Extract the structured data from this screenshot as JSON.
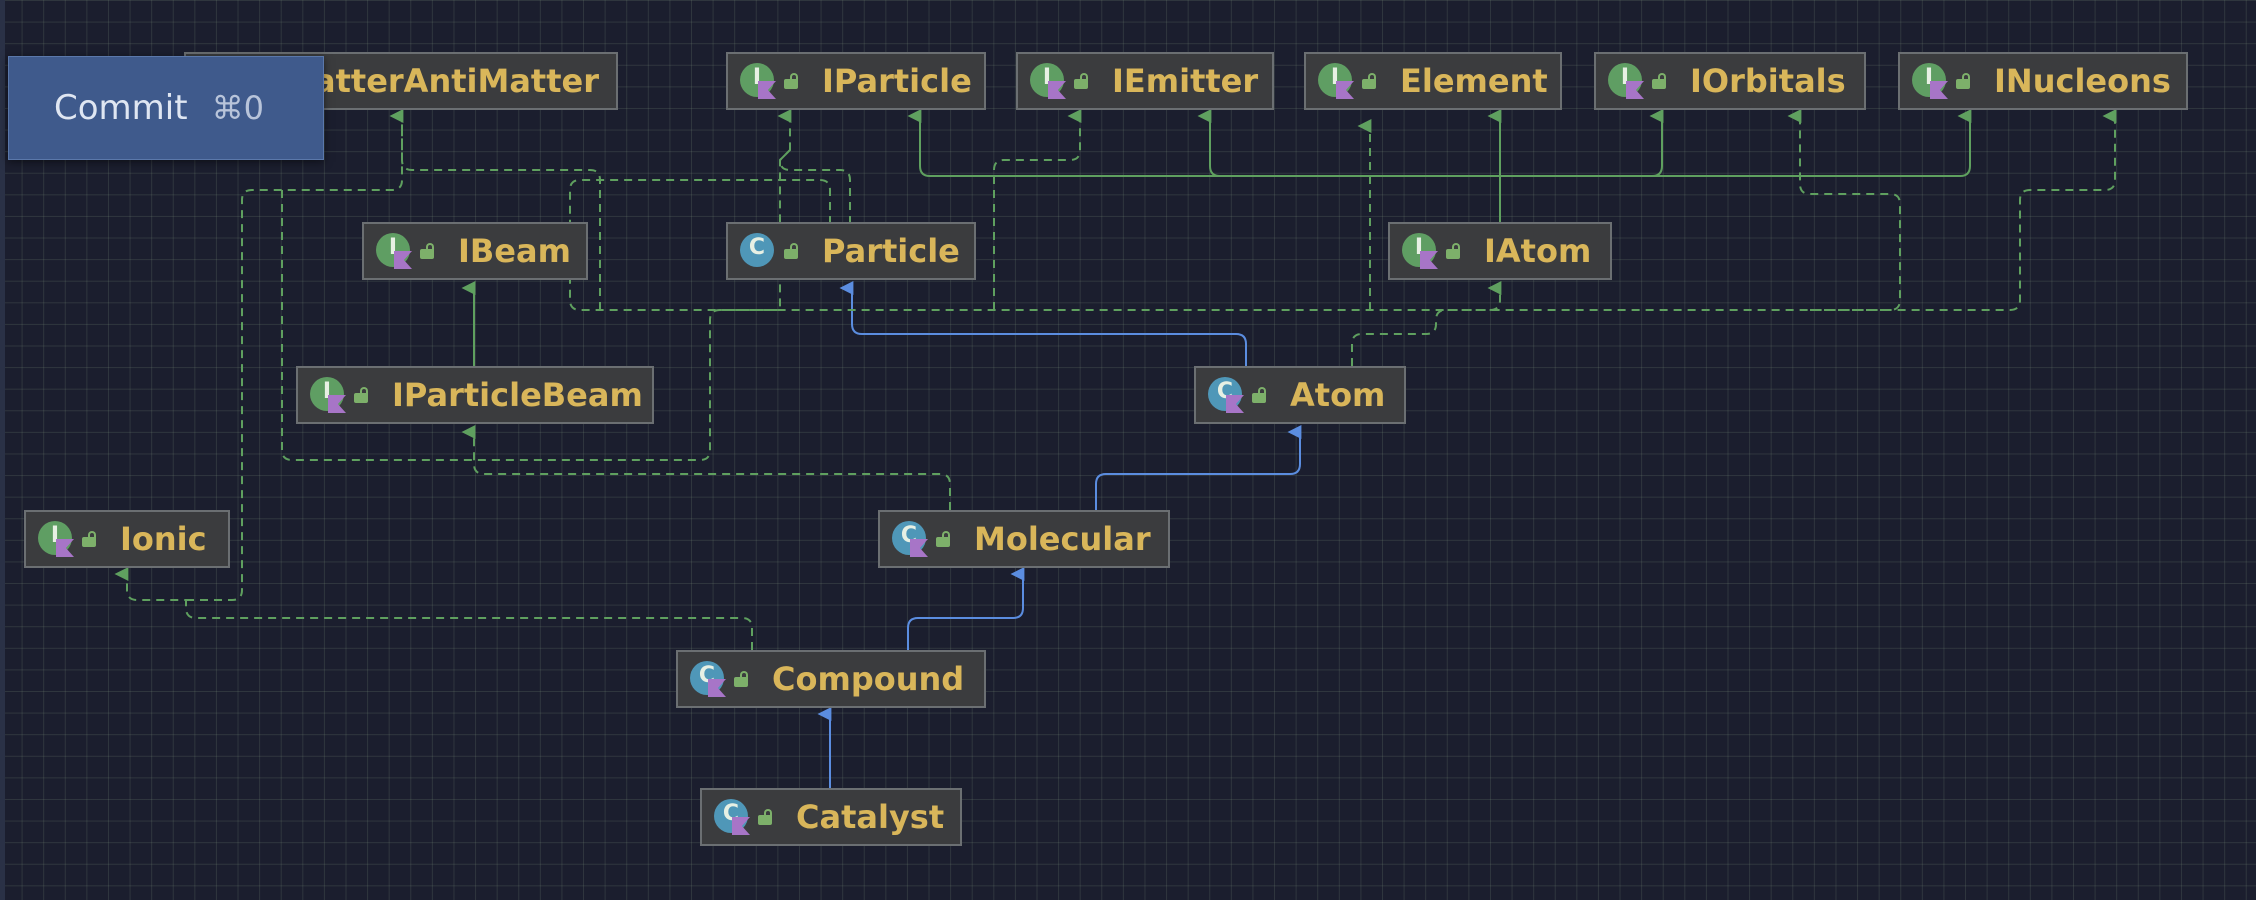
{
  "popup": {
    "label": "Commit",
    "shortcut": "⌘0"
  },
  "colors": {
    "background": "#1b1e2e",
    "node_fill": "#3b3c3e",
    "node_text": "#d9b65a",
    "interface_edge": "#5fa05f",
    "inheritance_edge": "#5b8de0",
    "interface_icon": "#5f9e63",
    "class_icon": "#4f97b8",
    "popup": "#3f5a8c"
  },
  "nodes": [
    {
      "id": "matterantimatter",
      "label": "atterAntiMatter",
      "kind": "interface",
      "icon": "interface-icon"
    },
    {
      "id": "iparticle",
      "label": "IParticle",
      "kind": "interface",
      "icon": "interface-icon"
    },
    {
      "id": "iemitter",
      "label": "IEmitter",
      "kind": "interface",
      "icon": "interface-icon"
    },
    {
      "id": "element",
      "label": "Element",
      "kind": "interface",
      "icon": "interface-icon"
    },
    {
      "id": "iorbitals",
      "label": "IOrbitals",
      "kind": "interface",
      "icon": "interface-icon"
    },
    {
      "id": "inucleons",
      "label": "INucleons",
      "kind": "interface",
      "icon": "interface-icon"
    },
    {
      "id": "ibeam",
      "label": "IBeam",
      "kind": "interface",
      "icon": "interface-icon"
    },
    {
      "id": "particle",
      "label": "Particle",
      "kind": "class",
      "icon": "class-icon"
    },
    {
      "id": "iatom",
      "label": "IAtom",
      "kind": "interface",
      "icon": "interface-icon"
    },
    {
      "id": "iparticlebeam",
      "label": "IParticleBeam",
      "kind": "interface",
      "icon": "interface-icon"
    },
    {
      "id": "atom",
      "label": "Atom",
      "kind": "class",
      "icon": "class-icon"
    },
    {
      "id": "ionic",
      "label": "Ionic",
      "kind": "interface",
      "icon": "interface-icon"
    },
    {
      "id": "molecular",
      "label": "Molecular",
      "kind": "class",
      "icon": "class-icon"
    },
    {
      "id": "compound",
      "label": "Compound",
      "kind": "class",
      "icon": "class-icon"
    },
    {
      "id": "catalyst",
      "label": "Catalyst",
      "kind": "class",
      "icon": "class-icon"
    }
  ],
  "edges": [
    {
      "from": "iatom",
      "to": "iparticle",
      "type": "extends-interface"
    },
    {
      "from": "iatom",
      "to": "iemitter",
      "type": "extends-interface"
    },
    {
      "from": "iatom",
      "to": "element",
      "type": "extends-interface"
    },
    {
      "from": "iatom",
      "to": "iorbitals",
      "type": "extends-interface"
    },
    {
      "from": "iatom",
      "to": "inucleons",
      "type": "extends-interface"
    },
    {
      "from": "iparticlebeam",
      "to": "ibeam",
      "type": "extends-interface"
    },
    {
      "from": "atom",
      "to": "particle",
      "type": "extends-class"
    },
    {
      "from": "atom",
      "to": "iatom",
      "type": "implements"
    },
    {
      "from": "molecular",
      "to": "atom",
      "type": "extends-class"
    },
    {
      "from": "molecular",
      "to": "iparticlebeam",
      "type": "implements"
    },
    {
      "from": "compound",
      "to": "molecular",
      "type": "extends-class"
    },
    {
      "from": "compound",
      "to": "ionic",
      "type": "implements"
    },
    {
      "from": "catalyst",
      "to": "compound",
      "type": "extends-class"
    },
    {
      "from": "particle",
      "to": "iparticle",
      "type": "implements"
    },
    {
      "from": "particle",
      "to": "iemitter",
      "type": "implements"
    },
    {
      "from": "particle",
      "to": "matterantimatter",
      "type": "implements"
    }
  ]
}
